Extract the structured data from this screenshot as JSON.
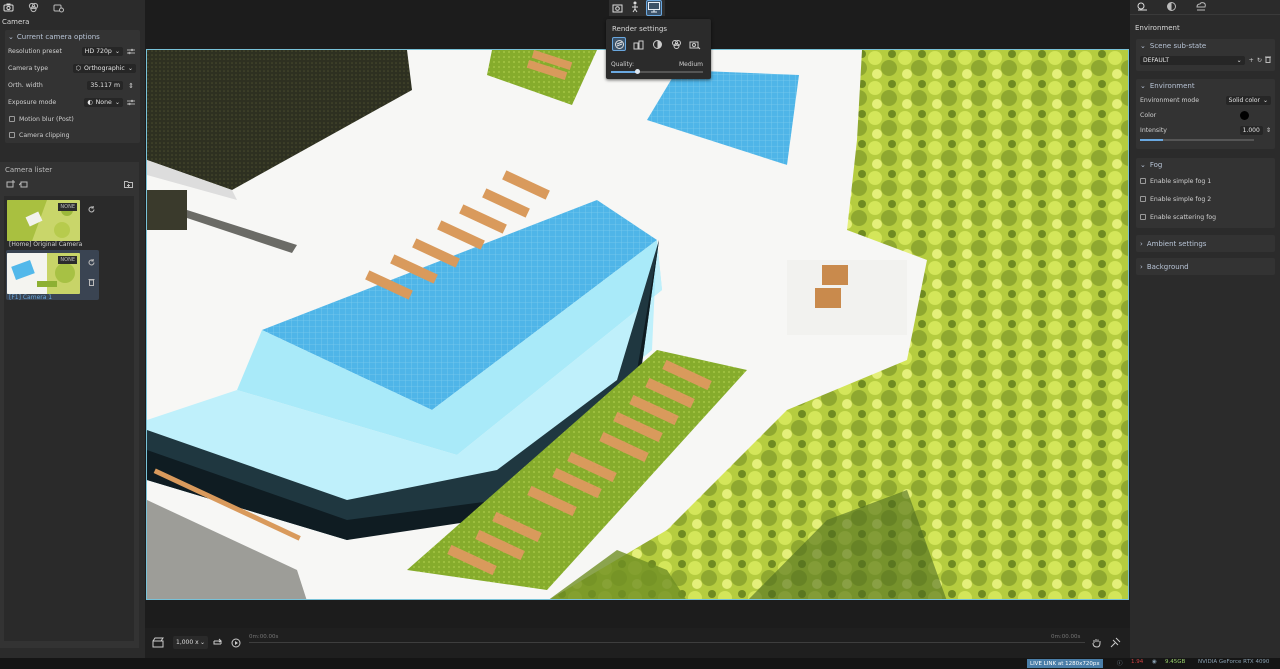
{
  "left_panel": {
    "section_title": "Camera",
    "current_camera": {
      "header": "Current camera options",
      "resolution_preset": {
        "label": "Resolution preset",
        "value": "HD 720p"
      },
      "camera_type": {
        "label": "Camera type",
        "value": "Orthographic"
      },
      "orth_width": {
        "label": "Orth. width",
        "value": "35.117 m"
      },
      "exposure_mode": {
        "label": "Exposure mode",
        "value": "None"
      },
      "motion_blur": "Motion blur (Post)",
      "camera_clipping": "Camera clipping"
    },
    "camera_lister": {
      "header": "Camera lister",
      "cameras": [
        {
          "label": "[Home] Original Camera",
          "badge": "NONE"
        },
        {
          "label": "[F1] Camera 1",
          "badge": "NONE"
        }
      ]
    }
  },
  "render_settings": {
    "title": "Render settings",
    "quality_label": "Quality:",
    "quality_value": "Medium",
    "quality_fraction": 0.28
  },
  "timeline": {
    "zoom": "1,000 x",
    "start_time": "0m:00.00s",
    "end_time": "0m:00.00s"
  },
  "right_panel": {
    "title": "Environment",
    "scene_substate": {
      "header": "Scene sub-state",
      "value": "DEFAULT"
    },
    "environment": {
      "header": "Environment",
      "mode_label": "Environment mode",
      "mode_value": "Solid color",
      "color_label": "Color",
      "color_value": "#000000",
      "intensity_label": "Intensity",
      "intensity_value": "1.000",
      "intensity_fraction": 0.2
    },
    "fog": {
      "header": "Fog",
      "options": [
        "Enable simple fog 1",
        "Enable simple fog 2",
        "Enable scattering fog"
      ]
    },
    "ambient_settings": "Ambient settings",
    "background": "Background"
  },
  "status_bar": {
    "live_link": "LIVE LINK at 1280x720px",
    "rec": "1.94",
    "memory": "9.45GB",
    "gpu": "NVIDIA GeForce RTX 4090"
  },
  "colors": {
    "accent": "#6aa8e0",
    "panel": "#2b2b2b",
    "pool_water": "#52b8ea",
    "grass": "#8db033",
    "deck": "#f7f7f5",
    "lounger": "#d99a5c"
  }
}
